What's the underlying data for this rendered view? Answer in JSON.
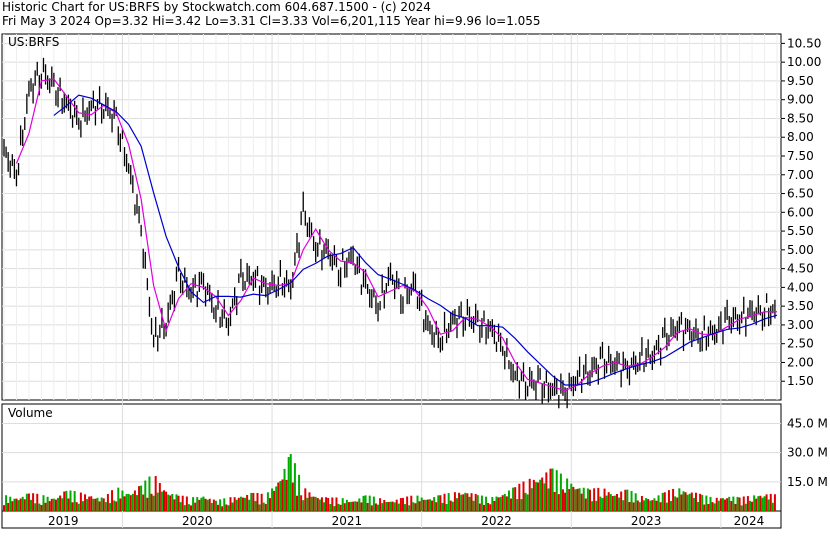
{
  "header": {
    "line1": "Historic Chart for US:BRFS by Stockwatch.com 604.687.1500 - (c) 2024",
    "line2": "Fri May  3 2024   Op=3.32  Hi=3.42  Lo=3.31  Cl=3.33  Vol=6,201,115  Year hi=9.96  lo=1.055"
  },
  "chart_data": {
    "type": "line",
    "symbol_label": "US:BRFS",
    "volume_label": "Volume",
    "price_ticks": [
      "10.50",
      "10.00",
      "9.50",
      "9.00",
      "8.50",
      "8.00",
      "7.50",
      "7.00",
      "6.50",
      "6.00",
      "5.50",
      "5.00",
      "4.50",
      "4.00",
      "3.50",
      "3.00",
      "2.50",
      "2.00",
      "1.50"
    ],
    "volume_ticks": [
      "45.0 M",
      "30.0 M",
      "15.0 M"
    ],
    "x_labels": [
      "2019",
      "2020",
      "2021",
      "2022",
      "2023",
      "2024"
    ],
    "ylim": [
      1.0,
      10.75
    ],
    "volume_ylim": [
      0,
      55
    ],
    "series": [
      {
        "name": "Price",
        "x": [
          "2019-03",
          "2019-04",
          "2019-05",
          "2019-06",
          "2019-07",
          "2019-08",
          "2019-09",
          "2019-10",
          "2019-11",
          "2019-12",
          "2020-01",
          "2020-02",
          "2020-03",
          "2020-04",
          "2020-05",
          "2020-06",
          "2020-07",
          "2020-08",
          "2020-09",
          "2020-10",
          "2020-11",
          "2020-12",
          "2021-01",
          "2021-02",
          "2021-03",
          "2021-04",
          "2021-05",
          "2021-06",
          "2021-07",
          "2021-08",
          "2021-09",
          "2021-10",
          "2021-11",
          "2021-12",
          "2022-01",
          "2022-02",
          "2022-03",
          "2022-04",
          "2022-05",
          "2022-06",
          "2022-07",
          "2022-08",
          "2022-09",
          "2022-10",
          "2022-11",
          "2022-12",
          "2023-01",
          "2023-02",
          "2023-03",
          "2023-04",
          "2023-05",
          "2023-06",
          "2023-07",
          "2023-08",
          "2023-09",
          "2023-10",
          "2023-11",
          "2023-12",
          "2024-01",
          "2024-02",
          "2024-03",
          "2024-04",
          "2024-05"
        ],
        "values": [
          7.6,
          7.0,
          9.2,
          9.8,
          9.3,
          8.9,
          8.4,
          8.8,
          8.9,
          8.4,
          7.2,
          5.5,
          2.6,
          3.1,
          4.3,
          3.9,
          4.1,
          3.4,
          3.1,
          4.2,
          4.3,
          3.9,
          4.2,
          4.0,
          6.0,
          5.1,
          4.9,
          4.5,
          4.8,
          4.0,
          3.5,
          4.3,
          3.8,
          4.0,
          2.9,
          2.6,
          3.1,
          3.3,
          3.0,
          2.9,
          2.4,
          1.6,
          1.5,
          1.4,
          1.3,
          1.2,
          1.6,
          1.8,
          2.0,
          2.0,
          1.8,
          2.1,
          2.2,
          2.6,
          3.0,
          2.8,
          2.7,
          2.8,
          3.1,
          3.2,
          3.3,
          3.4,
          3.3
        ]
      },
      {
        "name": "MA short",
        "color": "#e000e0"
      },
      {
        "name": "MA long",
        "color": "#0000cc"
      }
    ],
    "volume_series": {
      "name": "Volume",
      "values": [
        6,
        5,
        7,
        6,
        5,
        8,
        7,
        6,
        5,
        9,
        7,
        10,
        14,
        8,
        6,
        5,
        6,
        4,
        5,
        6,
        7,
        6,
        12,
        22,
        9,
        6,
        5,
        5,
        4,
        6,
        5,
        4,
        5,
        6,
        5,
        6,
        7,
        8,
        6,
        5,
        7,
        9,
        12,
        14,
        16,
        13,
        10,
        8,
        9,
        7,
        8,
        6,
        5,
        7,
        9,
        8,
        6,
        5,
        6,
        5,
        6,
        7,
        6
      ],
      "colors": {
        "up": "#00aa00",
        "down": "#dd0000"
      }
    },
    "grid": true,
    "legend": "none"
  }
}
